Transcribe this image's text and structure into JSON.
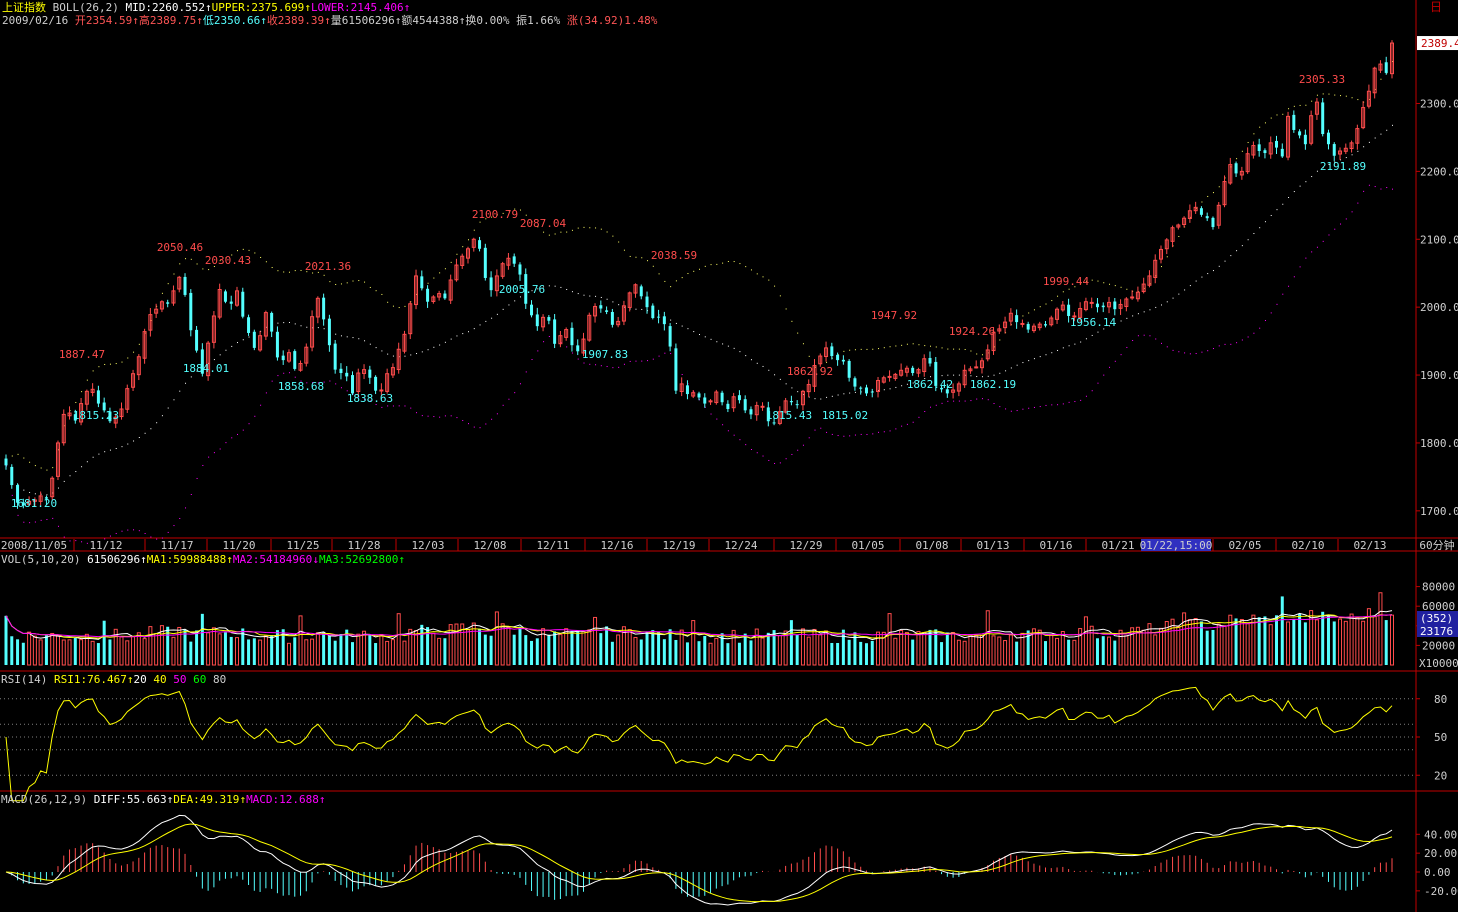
{
  "header": {
    "index_name": "上证指数",
    "indicator": "BOLL(26,2)",
    "mid": "MID:2260.552",
    "upper": "UPPER:2375.699",
    "lower": "LOWER:2145.406",
    "date": "2009/02/16",
    "open": "开2354.59",
    "high": "高2389.75",
    "low": "低2350.66",
    "close": "收2389.39",
    "volume": "量61506296",
    "amount": "额4544388",
    "turnover": "换0.00%",
    "amplitude": "振1.66%",
    "change": "涨(34.92)1.48%",
    "current_price_tag": "2389.4",
    "window_button": "日"
  },
  "colors": {
    "up": "#ff4c4c",
    "down": "#54ffff",
    "mid": "#ffffff",
    "upper": "#ffff66",
    "lower": "#ff00ff",
    "rsi": "#ffff00",
    "axis": "#c00000"
  },
  "chart_data": [
    {
      "type": "candlestick",
      "title": "上证指数 BOLL(26,2)",
      "ylim": [
        1660,
        2420
      ],
      "yticks": [
        1700,
        1800,
        1900,
        2000,
        2100,
        2200,
        2300
      ],
      "ytick_labels": [
        "1700.0",
        "1800.0",
        "1900.0",
        "2000.0",
        "2100.0",
        "2200.0",
        "2300.0"
      ],
      "date_labels": [
        "2008/11/05",
        "11/12",
        "11/17",
        "11/20",
        "11/25",
        "11/28",
        "12/03",
        "12/08",
        "12/11",
        "12/16",
        "12/19",
        "12/24",
        "12/29",
        "01/05",
        "01/08",
        "01/13",
        "01/16",
        "01/21",
        "01/22,15:00",
        "02/05",
        "02/10",
        "02/13"
      ],
      "period_label": "60分钟",
      "close": [
        1767,
        1738,
        1712,
        1708,
        1714,
        1716,
        1722,
        1718,
        1748,
        1800,
        1842,
        1844,
        1833,
        1858,
        1876,
        1879,
        1858,
        1848,
        1832,
        1838,
        1850,
        1880,
        1902,
        1927,
        1964,
        1989,
        1997,
        2008,
        2005,
        2024,
        2044,
        2018,
        1966,
        1936,
        1902,
        1947,
        1987,
        2026,
        2008,
        2005,
        2024,
        1986,
        1962,
        1940,
        1958,
        1992,
        1964,
        1926,
        1922,
        1933,
        1909,
        1917,
        1941,
        1986,
        2013,
        1982,
        1944,
        1908,
        1903,
        1898,
        1873,
        1903,
        1908,
        1896,
        1877,
        1878,
        1902,
        1911,
        1938,
        1960,
        2005,
        2046,
        2028,
        2008,
        2015,
        2020,
        2013,
        2040,
        2062,
        2075,
        2086,
        2100,
        2086,
        2043,
        2025,
        2046,
        2064,
        2072,
        2064,
        2048,
        2005,
        1988,
        1972,
        1985,
        1980,
        1946,
        1958,
        1967,
        1944,
        1935,
        1953,
        1988,
        2001,
        1998,
        1993,
        1974,
        1979,
        2002,
        2021,
        2033,
        2016,
        2000,
        1984,
        1985,
        1975,
        1942,
        1877,
        1887,
        1872,
        1874,
        1867,
        1858,
        1862,
        1875,
        1860,
        1850,
        1868,
        1863,
        1848,
        1842,
        1855,
        1854,
        1832,
        1829,
        1846,
        1862,
        1860,
        1856,
        1876,
        1886,
        1914,
        1928,
        1940,
        1928,
        1922,
        1920,
        1896,
        1883,
        1881,
        1873,
        1875,
        1892,
        1896,
        1898,
        1901,
        1907,
        1910,
        1903,
        1908,
        1924,
        1917,
        1884,
        1879,
        1873,
        1878,
        1887,
        1907,
        1909,
        1912,
        1921,
        1937,
        1963,
        1968,
        1978,
        1991,
        1978,
        1976,
        1967,
        1972,
        1975,
        1973,
        1984,
        1997,
        2003,
        1987,
        1987,
        1998,
        2008,
        2007,
        2000,
        2000,
        2007,
        1997,
        2004,
        2012,
        2015,
        2022,
        2034,
        2046,
        2069,
        2085,
        2099,
        2117,
        2121,
        2131,
        2142,
        2147,
        2136,
        2131,
        2118,
        2150,
        2185,
        2210,
        2197,
        2200,
        2226,
        2238,
        2230,
        2227,
        2242,
        2235,
        2222,
        2281,
        2261,
        2253,
        2240,
        2282,
        2302,
        2255,
        2240,
        2223,
        2230,
        2234,
        2242,
        2263,
        2294,
        2318,
        2352,
        2358,
        2345,
        2389
      ]
    },
    {
      "type": "bar",
      "title": "VOL(5,10,20)",
      "legend": [
        "61506296",
        "MA1:59988488",
        "MA2:54184960",
        "MA3:52692800"
      ],
      "ylim": [
        0,
        100000
      ],
      "yticks": [
        20000,
        40000,
        60000,
        80000
      ],
      "ytick_labels": [
        "20000",
        "40000",
        "60000",
        "80000"
      ],
      "unit_label": "X10000",
      "tag_count": "(352)",
      "tag_value": "23176"
    },
    {
      "type": "line",
      "title": "RSI(14)",
      "legend": [
        "RSI1:76.467",
        "20",
        "40",
        "50",
        "60",
        "80"
      ],
      "ylim": [
        10,
        90
      ],
      "yticks": [
        20,
        50,
        80
      ],
      "ytick_labels": [
        "20",
        "50",
        "80"
      ]
    },
    {
      "type": "line",
      "title": "MACD(26,12,9)",
      "legend": [
        "DIFF:55.663",
        "DEA:49.319",
        "MACD:12.688"
      ],
      "ylim": [
        -35,
        70
      ],
      "yticks": [
        -20,
        0,
        20,
        40
      ],
      "ytick_labels": [
        "-20.00",
        "0.00",
        "20.00",
        "40.00"
      ]
    }
  ],
  "annotations": [
    {
      "text": "1681.20",
      "color": "down"
    },
    {
      "text": "1815.23",
      "color": "down"
    },
    {
      "text": "1887.47",
      "color": "up"
    },
    {
      "text": "2050.46",
      "color": "up"
    },
    {
      "text": "1884.01",
      "color": "down"
    },
    {
      "text": "2030.43",
      "color": "up"
    },
    {
      "text": "1858.68",
      "color": "down"
    },
    {
      "text": "2021.36",
      "color": "up"
    },
    {
      "text": "1838.63",
      "color": "down"
    },
    {
      "text": "2100.79",
      "color": "up"
    },
    {
      "text": "2087.04",
      "color": "up"
    },
    {
      "text": "2005.76",
      "color": "down"
    },
    {
      "text": "1907.83",
      "color": "down"
    },
    {
      "text": "2038.59",
      "color": "up"
    },
    {
      "text": "1815.43",
      "color": "down"
    },
    {
      "text": "1862.92",
      "color": "up"
    },
    {
      "text": "1815.02",
      "color": "down"
    },
    {
      "text": "1947.92",
      "color": "up"
    },
    {
      "text": "1862.42",
      "color": "down"
    },
    {
      "text": "1924.26",
      "color": "up"
    },
    {
      "text": "1862.19",
      "color": "down"
    },
    {
      "text": "1999.44",
      "color": "up"
    },
    {
      "text": "1956.14",
      "color": "down"
    },
    {
      "text": "2305.33",
      "color": "up"
    },
    {
      "text": "2191.89",
      "color": "down"
    }
  ]
}
